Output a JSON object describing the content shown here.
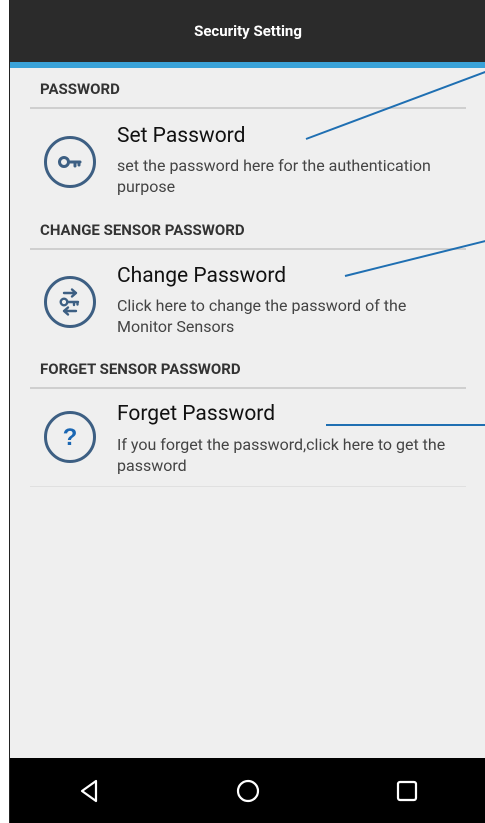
{
  "appbar": {
    "title": "Security Setting"
  },
  "sections": [
    {
      "header": "PASSWORD",
      "item": {
        "title": "Set Password",
        "description": "set the password here for the authentication purpose",
        "icon": "key-icon"
      }
    },
    {
      "header": "CHANGE SENSOR PASSWORD",
      "item": {
        "title": "Change Password",
        "description": "Click here to change the password of the Monitor Sensors",
        "icon": "key-exchange-icon"
      }
    },
    {
      "header": "FORGET SENSOR PASSWORD",
      "item": {
        "title": "Forget Password",
        "description": "If you forget the password,click here to get the password",
        "icon": "question-icon"
      }
    }
  ],
  "navbar": {
    "buttons": [
      "back-icon",
      "home-icon",
      "recents-icon"
    ]
  },
  "colors": {
    "appbar": "#2b2b2b",
    "accent": "#3aa2d8",
    "icon_stroke": "#3d5f83",
    "callout": "#1f6fb2"
  }
}
